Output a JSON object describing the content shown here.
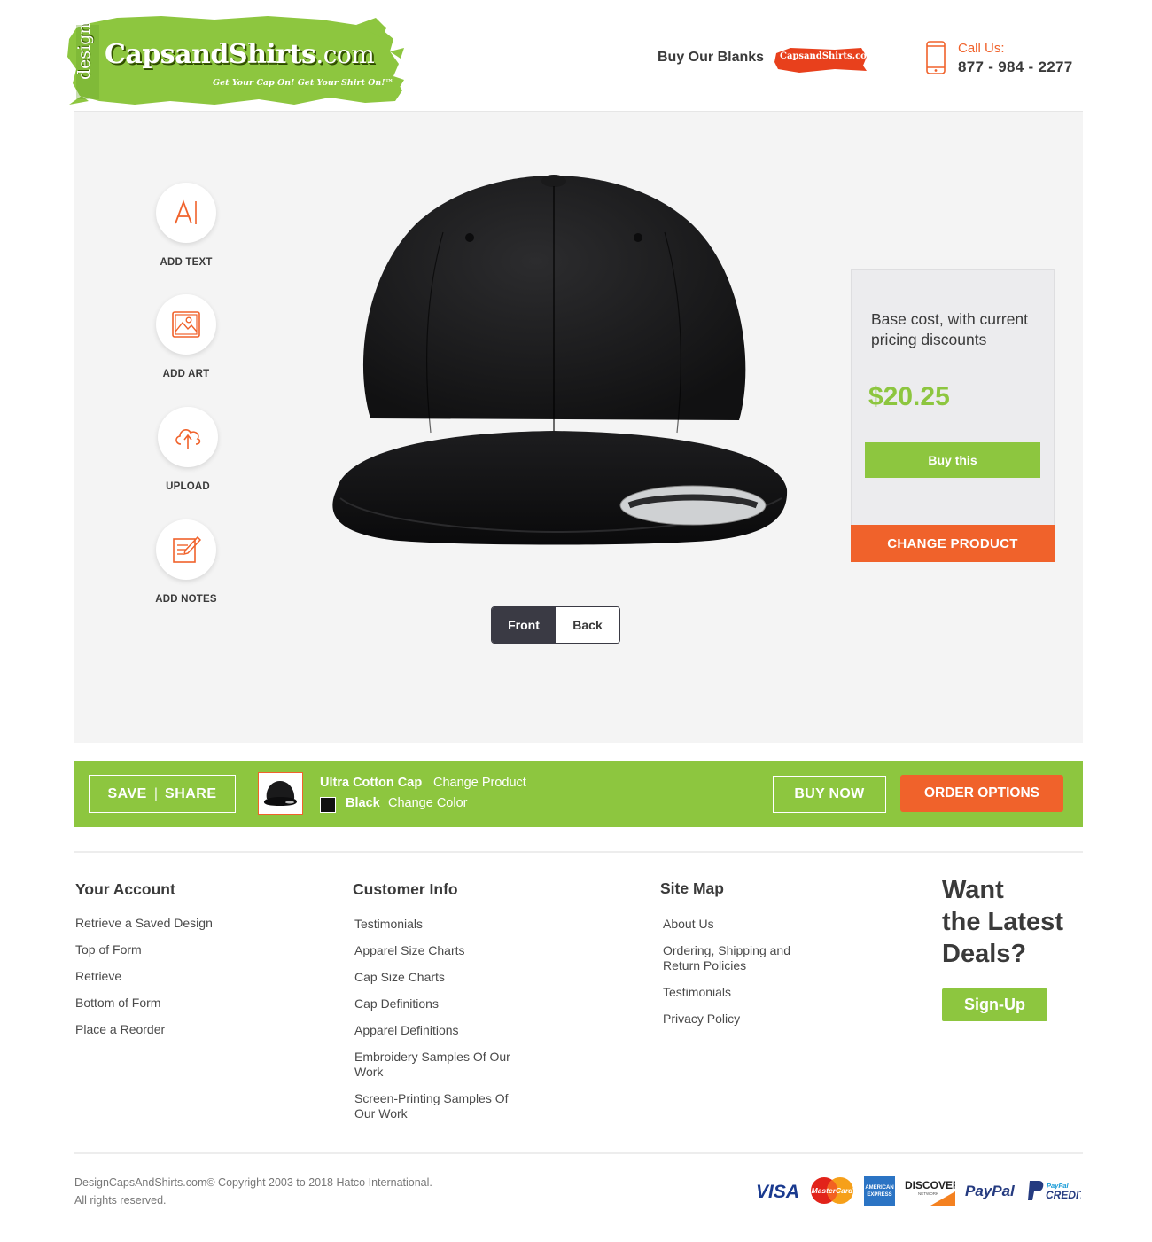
{
  "header": {
    "logo": {
      "design": "design",
      "main": "CapsandShirts",
      "com": ".com",
      "tagline": "Get Your Cap On! Get Your Shirt On!™"
    },
    "buy_blanks": "Buy Our Blanks",
    "mini_logo_text": "CapsandShirts.com",
    "call_label": "Call Us:",
    "call_number": "877 - 984 - 2277"
  },
  "tools": [
    {
      "label": "ADD TEXT",
      "icon": "text-icon"
    },
    {
      "label": "ADD ART",
      "icon": "image-icon"
    },
    {
      "label": "UPLOAD",
      "icon": "cloud-upload-icon"
    },
    {
      "label": "ADD NOTES",
      "icon": "notes-icon"
    }
  ],
  "view_toggle": {
    "front": "Front",
    "back": "Back",
    "selected": "Front"
  },
  "pricing": {
    "description": "Base cost, with current pricing discounts",
    "price": "$20.25",
    "buy_label": "Buy this",
    "change_product_label": "CHANGE PRODUCT"
  },
  "action_bar": {
    "save": "SAVE",
    "divider": "|",
    "share": "SHARE",
    "product_name": "Ultra Cotton Cap",
    "change_product": "Change Product",
    "color_name": "Black",
    "change_color": "Change Color",
    "buy_now": "BUY NOW",
    "order_options": "ORDER OPTIONS"
  },
  "footer": {
    "your_account": {
      "title": "Your Account",
      "links": [
        "Retrieve a Saved Design",
        "Top of Form",
        "Retrieve",
        "Bottom of Form",
        "Place a Reorder"
      ]
    },
    "customer_info": {
      "title": "Customer Info",
      "links": [
        "Testimonials",
        "Apparel Size Charts",
        "Cap Size Charts",
        "Cap Definitions",
        "Apparel Definitions",
        "Embroidery Samples Of Our Work",
        "Screen-Printing Samples Of Our Work"
      ]
    },
    "site_map": {
      "title": "Site Map",
      "links": [
        "About Us",
        "Ordering, Shipping and Return Policies",
        "Testimonials",
        "Privacy Policy"
      ]
    },
    "deals": {
      "line1": "Want",
      "line2": "the Latest",
      "line3": "Deals?",
      "signup": "Sign-Up"
    },
    "copyright_line1": "DesignCapsAndShirts.com© Copyright 2003 to 2018 Hatco International.",
    "copyright_line2": "All rights reserved.",
    "payments": {
      "visa": "VISA",
      "mastercard": "MasterCard",
      "amex1": "AMERICAN",
      "amex2": "EXPRESS",
      "discover": "DISCOVER",
      "discover_sub": "NETWORK",
      "paypal": "PayPal",
      "paypal_credit1": "PayPal",
      "paypal_credit2": "CREDIT"
    }
  },
  "colors": {
    "green": "#8dc63f",
    "orange": "#f0622b",
    "dark": "#3a3a44"
  }
}
